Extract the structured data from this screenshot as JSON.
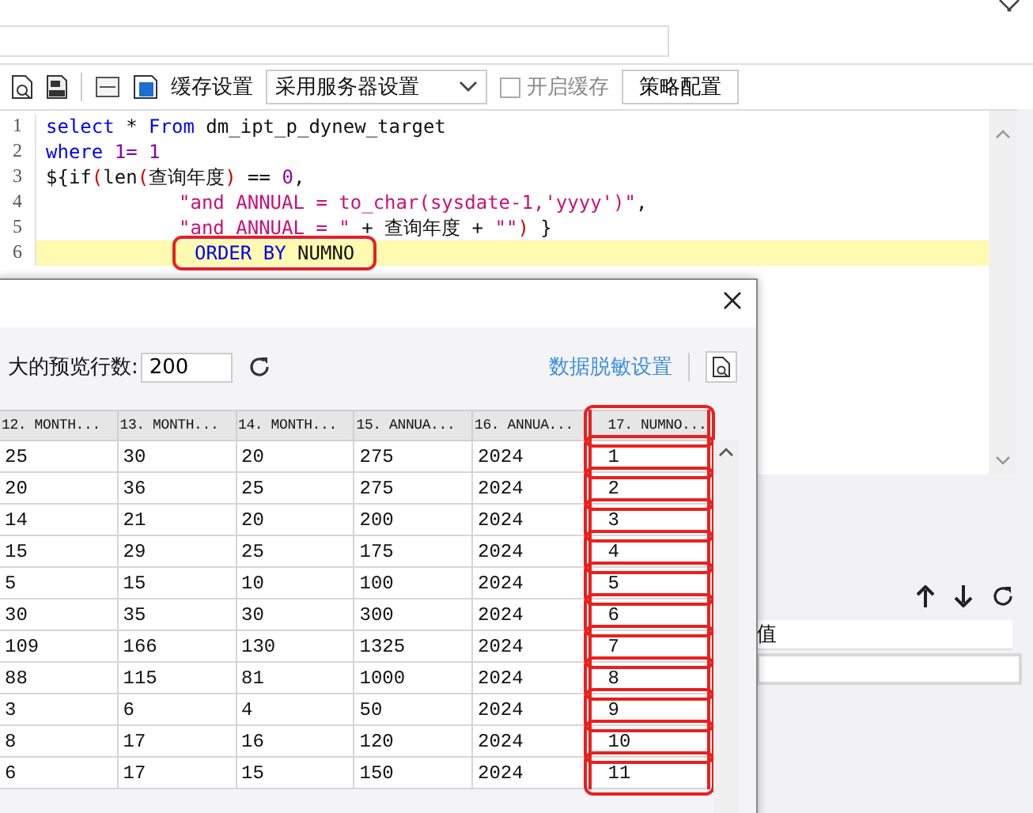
{
  "toolbar": {
    "cache_label": "缓存设置",
    "cache_select": "采用服务器设置",
    "enable_cache": {
      "label": "开启缓存",
      "checked": false,
      "disabled": true
    },
    "strategy_button": "策略配置"
  },
  "editor": {
    "lines": [
      {
        "number": "1",
        "indented": false,
        "current": false,
        "annotated": false,
        "tokens": [
          {
            "kind": "keyword",
            "text": "select"
          },
          {
            "kind": "plain",
            "text": " * "
          },
          {
            "kind": "keyword",
            "text": "From"
          },
          {
            "kind": "plain",
            "text": " dm_ipt_p_dynew_target"
          }
        ]
      },
      {
        "number": "2",
        "indented": false,
        "current": false,
        "annotated": false,
        "tokens": [
          {
            "kind": "keyword",
            "text": "where"
          },
          {
            "kind": "number",
            "text": " 1= 1"
          }
        ]
      },
      {
        "number": "3",
        "indented": false,
        "current": false,
        "annotated": false,
        "tokens": [
          {
            "kind": "plain",
            "text": "${if"
          },
          {
            "kind": "paren",
            "text": "("
          },
          {
            "kind": "plain",
            "text": "len"
          },
          {
            "kind": "paren",
            "text": "("
          },
          {
            "kind": "plain",
            "text": "查询年度"
          },
          {
            "kind": "paren",
            "text": ")"
          },
          {
            "kind": "plain",
            "text": " == "
          },
          {
            "kind": "number",
            "text": "0"
          },
          {
            "kind": "plain",
            "text": ","
          }
        ]
      },
      {
        "number": "4",
        "indented": true,
        "current": false,
        "annotated": false,
        "tokens": [
          {
            "kind": "string",
            "text": "\"and ANNUAL = to_char(sysdate-1,'yyyy')\""
          },
          {
            "kind": "plain",
            "text": ","
          }
        ]
      },
      {
        "number": "5",
        "indented": true,
        "current": false,
        "annotated": false,
        "tokens": [
          {
            "kind": "string",
            "text": "\"and ANNUAL = \""
          },
          {
            "kind": "plain",
            "text": " + 查询年度 + "
          },
          {
            "kind": "string",
            "text": "\"\""
          },
          {
            "kind": "paren",
            "text": ")"
          },
          {
            "kind": "plain",
            "text": " }"
          }
        ]
      },
      {
        "number": "6",
        "indented": true,
        "current": true,
        "annotated": true,
        "tokens": [
          {
            "kind": "keyword",
            "text": "ORDER BY"
          },
          {
            "kind": "plain",
            "text": " NUMNO"
          }
        ]
      }
    ]
  },
  "right_panel": {
    "value_header": "值"
  },
  "preview_dialog": {
    "max_rows_label": "大的预览行数:",
    "max_rows_value": "200",
    "masking_link": "数据脱敏设置",
    "columns": [
      {
        "label": "12. MONTH...",
        "annotated": false
      },
      {
        "label": "13. MONTH...",
        "annotated": false
      },
      {
        "label": "14. MONTH...",
        "annotated": false
      },
      {
        "label": "15. ANNUA...",
        "annotated": false
      },
      {
        "label": "16. ANNUA...",
        "annotated": false
      },
      {
        "label": "17. NUMNO...",
        "annotated": true
      }
    ],
    "rows": [
      [
        "25",
        "30",
        "20",
        "275",
        "2024",
        "1"
      ],
      [
        "20",
        "36",
        "25",
        "275",
        "2024",
        "2"
      ],
      [
        "14",
        "21",
        "20",
        "200",
        "2024",
        "3"
      ],
      [
        "15",
        "29",
        "25",
        "175",
        "2024",
        "4"
      ],
      [
        "5",
        "15",
        "10",
        "100",
        "2024",
        "5"
      ],
      [
        "30",
        "35",
        "30",
        "300",
        "2024",
        "6"
      ],
      [
        "109",
        "166",
        "130",
        "1325",
        "2024",
        "7"
      ],
      [
        "88",
        "115",
        "81",
        "1000",
        "2024",
        "8"
      ],
      [
        "3",
        "6",
        "4",
        "50",
        "2024",
        "9"
      ],
      [
        "8",
        "17",
        "16",
        "120",
        "2024",
        "10"
      ],
      [
        "6",
        "17",
        "15",
        "150",
        "2024",
        "11"
      ]
    ]
  }
}
